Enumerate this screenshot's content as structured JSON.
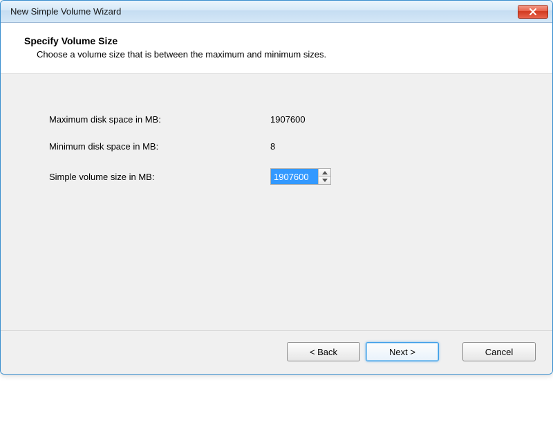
{
  "titlebar": {
    "title": "New Simple Volume Wizard"
  },
  "header": {
    "title": "Specify Volume Size",
    "subtitle": "Choose a volume size that is between the maximum and minimum sizes."
  },
  "form": {
    "max_label": "Maximum disk space in MB:",
    "max_value": "1907600",
    "min_label": "Minimum disk space in MB:",
    "min_value": "8",
    "size_label": "Simple volume size in MB:",
    "size_value": "1907600"
  },
  "footer": {
    "back": "< Back",
    "next": "Next >",
    "cancel": "Cancel"
  }
}
